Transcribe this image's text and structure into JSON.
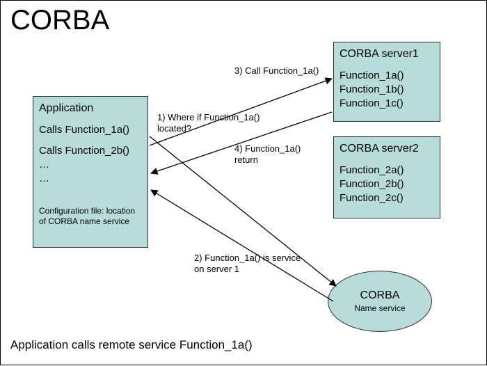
{
  "title": "CORBA",
  "caption": "Application calls remote service Function_1a()",
  "app": {
    "header": "Application",
    "line1": "Calls Function_1a()",
    "line2": "Calls Function_2b()",
    "line3": "…",
    "line4": "…",
    "conf": "Configuration file: location of CORBA name service"
  },
  "server1": {
    "header": "CORBA server1",
    "f1": "Function_1a()",
    "f2": "Function_1b()",
    "f3": "Function_1c()"
  },
  "server2": {
    "header": "CORBA server2",
    "f1": "Function_2a()",
    "f2": "Function_2b()",
    "f3": "Function_2c()"
  },
  "nameservice": {
    "line1": "CORBA",
    "line2": "Name service"
  },
  "labels": {
    "l1": "1) Where if Function_1a()\nlocated?",
    "l2": "2) Function_1a() is service\non server 1",
    "l3": "3) Call Function_1a()",
    "l4": "4) Function_1a()\nreturn"
  },
  "colors": {
    "box_fill": "#b7dcd9",
    "stroke": "#2b2b2b"
  }
}
